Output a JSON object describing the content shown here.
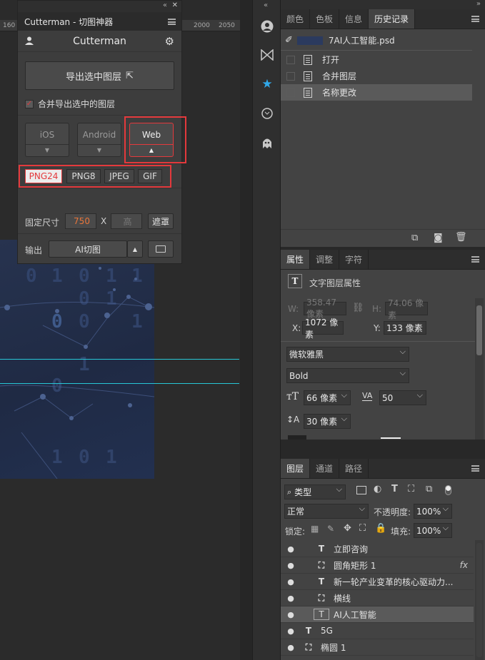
{
  "ruler": {
    "ticks": [
      "160",
      "2000",
      "2050"
    ]
  },
  "design": {
    "digits": [
      "0",
      "1",
      "0",
      "1",
      "1",
      "0",
      "1",
      "0",
      "0",
      "1",
      "1",
      "0",
      "1",
      "0",
      "1"
    ]
  },
  "cutterman": {
    "window_title": "Cutterman - 切图神器",
    "brand": "Cutterman",
    "export_button": "导出选中图层",
    "merge_checkbox_label": "合并导出选中的图层",
    "platforms": [
      {
        "label": "iOS",
        "arrow": "▼",
        "selected": false
      },
      {
        "label": "Android",
        "arrow": "▼",
        "selected": false
      },
      {
        "label": "Web",
        "arrow": "▲",
        "selected": true
      }
    ],
    "formats": [
      "PNG24",
      "PNG8",
      "JPEG",
      "GIF"
    ],
    "selected_format": "PNG24",
    "size_label": "固定尺寸",
    "width_value": "750",
    "x_label": "X",
    "height_placeholder": "高",
    "mask_button": "遮罩",
    "output_label": "输出",
    "output_value": "AI切图",
    "up_arrow": "▲",
    "colors": {
      "accent": "#e4393c",
      "value_orange": "#e8753a"
    }
  },
  "history_panel": {
    "tabs": [
      "颜色",
      "色板",
      "信息",
      "历史记录"
    ],
    "active_tab": "历史记录",
    "snapshot_name": "7AI人工智能.psd",
    "items": [
      "打开",
      "合并图层",
      "名称更改"
    ],
    "selected_item": "名称更改"
  },
  "properties_panel": {
    "tabs": [
      "属性",
      "调整",
      "字符"
    ],
    "active_tab": "属性",
    "title": "文字图层属性",
    "w_label": "W:",
    "w_value": "358.47 像素",
    "h_label": "H:",
    "h_value": "74.06 像素",
    "x_label": "X:",
    "x_value": "1072 像素",
    "y_label": "Y:",
    "y_value": "133 像素",
    "font_family": "微软雅黑",
    "font_style": "Bold",
    "font_size": "66 像素",
    "tracking": "50",
    "leading": "30 像素"
  },
  "layers_panel": {
    "tabs": [
      "图层",
      "通道",
      "路径"
    ],
    "active_tab": "图层",
    "filter_label": "类型",
    "blend_mode": "正常",
    "opacity_label": "不透明度:",
    "opacity_value": "100%",
    "lock_label": "锁定:",
    "fill_label": "填充:",
    "fill_value": "100%",
    "fx_label": "fx",
    "layers": [
      {
        "name": "立即咨询",
        "kind": "T",
        "selected": false
      },
      {
        "name": "圆角矩形 1",
        "kind": "shape",
        "selected": false
      },
      {
        "name": "新一轮产业变革的核心驱动力...",
        "kind": "T",
        "selected": false
      },
      {
        "name": "横线",
        "kind": "shape",
        "selected": false
      },
      {
        "name": "AI人工智能",
        "kind": "T",
        "selected": true
      },
      {
        "name": "5G",
        "kind": "T",
        "selected": false
      },
      {
        "name": "椭圆 1",
        "kind": "shape",
        "selected": false
      }
    ]
  }
}
